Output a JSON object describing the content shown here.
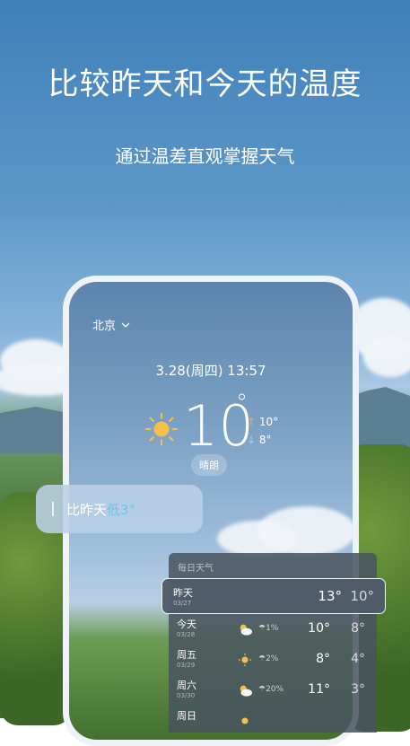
{
  "headline": "比较昨天和今天的温度",
  "subline": "通过温差直观掌握天气",
  "phone": {
    "city": "北京",
    "datetime": "3.28(周四) 13:57",
    "temperature": "10",
    "degree_symbol": "°",
    "high": "10°",
    "low": "8°",
    "condition": "晴朗",
    "icon": "sun-icon"
  },
  "compare_card": {
    "prefix": "比昨天",
    "delta": "低3°"
  },
  "daily": {
    "title": "每日天气",
    "selected": {
      "day": "昨天",
      "date": "03/27",
      "high": "13°",
      "low": "10°"
    },
    "rows": [
      {
        "day": "今天",
        "date": "03/28",
        "icon": "partly-cloudy-icon",
        "rain": "1%",
        "high": "10°",
        "low": "8°"
      },
      {
        "day": "周五",
        "date": "03/29",
        "icon": "sun-icon",
        "rain": "2%",
        "high": "8°",
        "low": "4°"
      },
      {
        "day": "周六",
        "date": "03/30",
        "icon": "partly-cloudy-icon",
        "rain": "20%",
        "high": "11°",
        "low": "3°"
      },
      {
        "day": "周日",
        "date": "",
        "icon": "sun-icon",
        "rain": "",
        "high": "",
        "low": ""
      }
    ]
  },
  "colors": {
    "accent_low": "#62c7ec",
    "sun_fill": "#f3c04a"
  }
}
